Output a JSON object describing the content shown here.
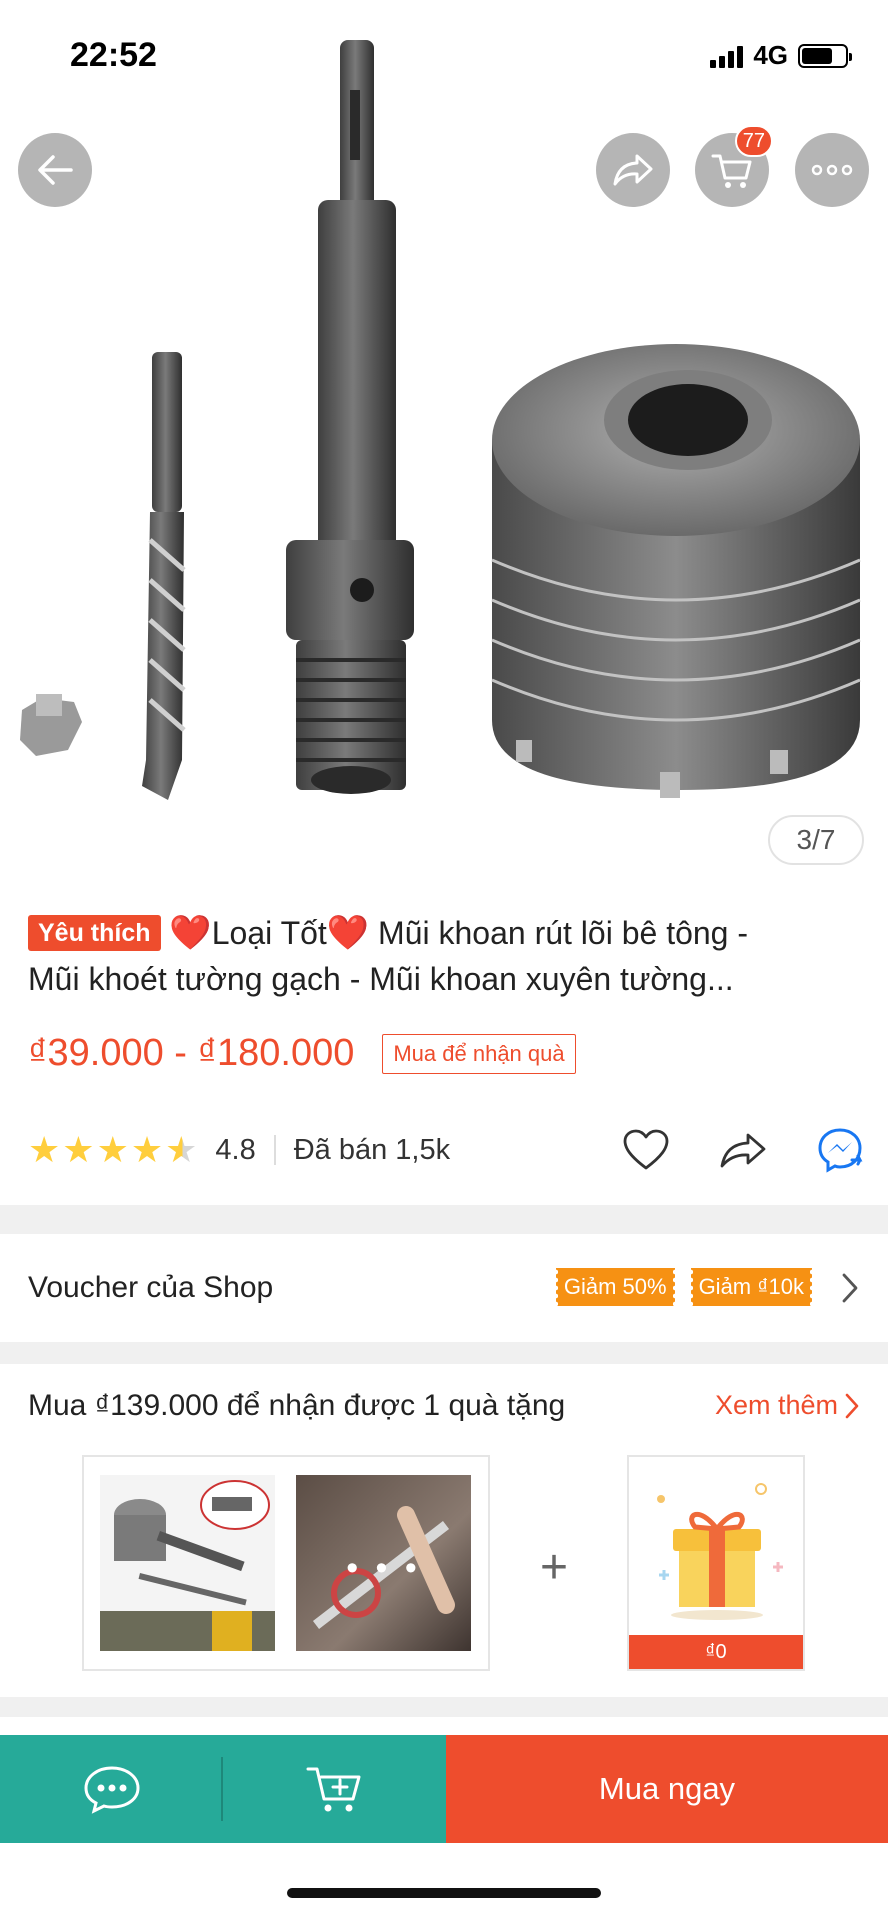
{
  "status_bar": {
    "time": "22:52",
    "network": "4G"
  },
  "header": {
    "cart_count": "77"
  },
  "gallery": {
    "counter": "3/7"
  },
  "product": {
    "favorite_tag": "Yêu thích",
    "heart_glyph": "❤️",
    "title_part1": "Loại Tốt",
    "title_part2": " Mũi khoan rút lõi bê tông -",
    "title_line2": "Mũi khoét tường gạch - Mũi khoan xuyên tường...",
    "price": "₫39.000 - ₫180.000",
    "gift_badge": "Mua để nhận quà",
    "rating": "4.8",
    "rating_stars": 4.5,
    "sold": "Đã bán 1,5k"
  },
  "voucher": {
    "label": "Voucher của Shop",
    "chips": [
      "Giảm 50%",
      "Giảm ₫10k"
    ]
  },
  "bundle": {
    "title": "Mua ₫139.000 để nhận được 1 quà tặng",
    "see_more": "Xem thêm",
    "more_dots": "• • •",
    "plus": "+",
    "gift_price": "₫0"
  },
  "bottom_bar": {
    "buy_now": "Mua ngay"
  },
  "colors": {
    "accent": "#ee4d2d",
    "teal": "#26aa99",
    "star": "#ffce3d",
    "voucher_chip": "#f69113",
    "messenger": "#1877f2"
  },
  "icons": [
    "back-icon",
    "share-icon",
    "cart-icon",
    "more-icon",
    "heart-outline-icon",
    "share-outline-icon",
    "messenger-icon",
    "chat-icon",
    "add-to-cart-icon",
    "chevron-right-icon",
    "gift-icon"
  ]
}
